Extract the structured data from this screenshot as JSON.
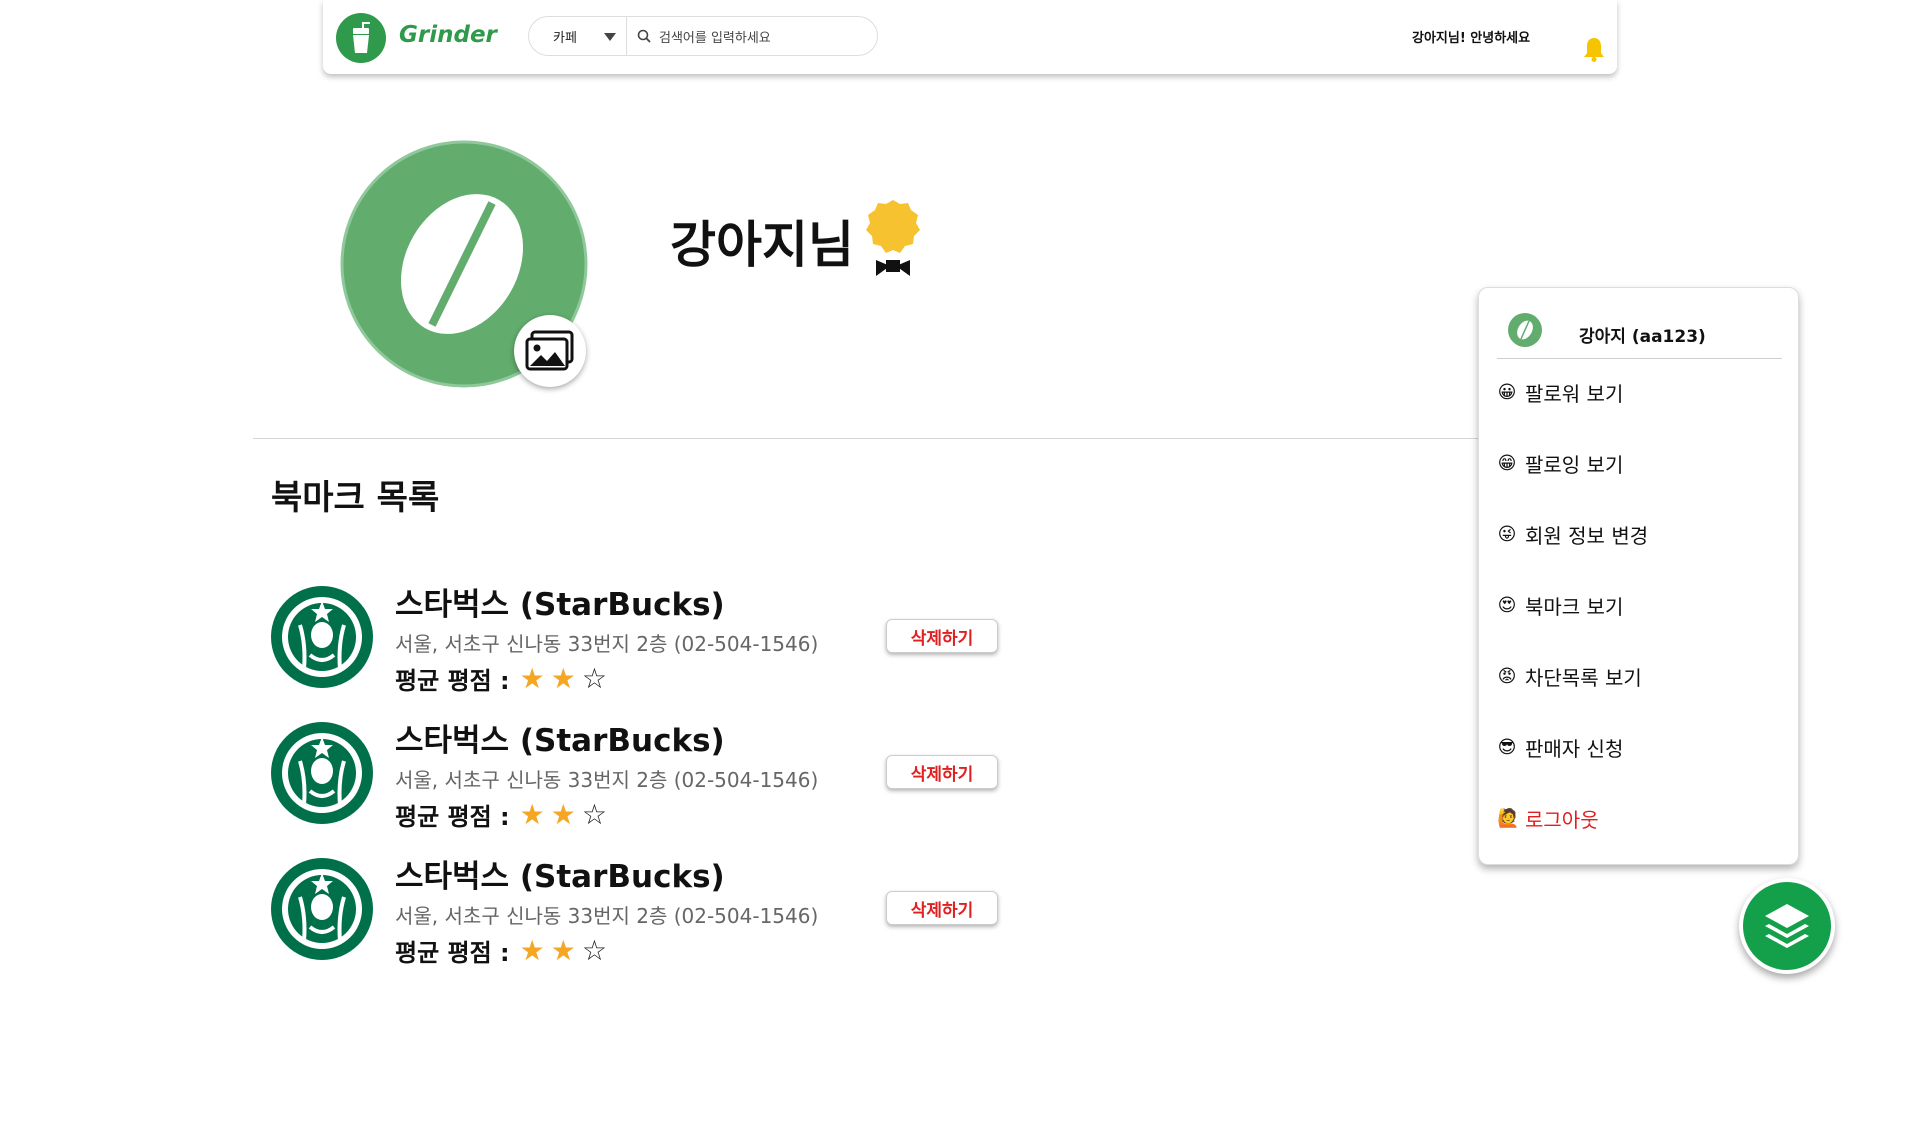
{
  "header": {
    "brand": "Grinder",
    "search": {
      "category": "카페",
      "placeholder": "검색어를 입력하세요"
    },
    "greeting": "강아지님! 안녕하세요"
  },
  "profile": {
    "name": "강아지님"
  },
  "bookmarks": {
    "title": "북마크 목록",
    "rating_label": "평균 평점 :",
    "items": [
      {
        "name": "스타벅스 (StarBucks)",
        "address": "서울, 서초구 신나동 33번지 2층 (02-504-1546)",
        "rating": 2,
        "max_rating": 3,
        "delete_label": "삭제하기"
      },
      {
        "name": "스타벅스 (StarBucks)",
        "address": "서울, 서초구 신나동 33번지 2층 (02-504-1546)",
        "rating": 2,
        "max_rating": 3,
        "delete_label": "삭제하기"
      },
      {
        "name": "스타벅스 (StarBucks)",
        "address": "서울, 서초구 신나동 33번지 2층 (02-504-1546)",
        "rating": 2,
        "max_rating": 3,
        "delete_label": "삭제하기"
      }
    ]
  },
  "menu": {
    "user": "강아지 (aa123)",
    "items": [
      {
        "emoji": "😀",
        "label": "팔로워 보기"
      },
      {
        "emoji": "😁",
        "label": "팔로잉 보기"
      },
      {
        "emoji": "😜",
        "label": "회원 정보 변경"
      },
      {
        "emoji": "😍",
        "label": "북마크 보기"
      },
      {
        "emoji": "😡",
        "label": "차단목록 보기"
      },
      {
        "emoji": "😎",
        "label": "판매자 신청"
      },
      {
        "emoji": "🙋",
        "label": "로그아웃"
      }
    ]
  },
  "colors": {
    "brand_green": "#2f9a4c",
    "avatar_green": "#62ad6e",
    "danger": "#e02020",
    "star": "#f5a623",
    "fab": "#14a04a"
  },
  "icons": [
    "grinder-logo-icon",
    "caret-down-icon",
    "search-icon",
    "bell-icon",
    "bean-avatar",
    "image-upload-icon",
    "badge-icon",
    "starbucks-logo",
    "layers-icon"
  ]
}
